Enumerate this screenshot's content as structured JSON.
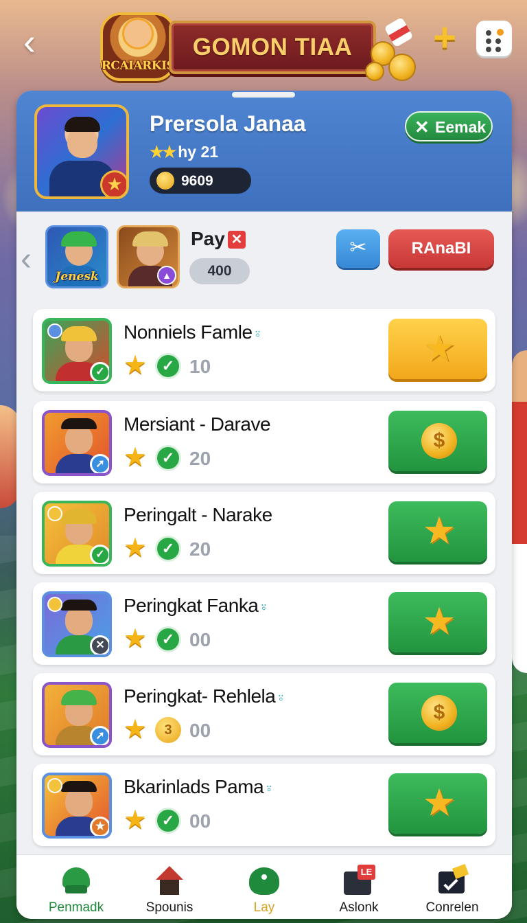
{
  "header": {
    "back_icon": "back-chevron-icon",
    "logo_text": "RCAIARKIS",
    "title": "GOMON TIAA",
    "plus_icon": "plus-icon",
    "menu_icon": "menu-dots-icon"
  },
  "profile": {
    "name": "Prersola Janaa",
    "level_stars": "★★",
    "level_text": "hy 21",
    "coins": "9609",
    "exit_label": "Eemak"
  },
  "quick_row": {
    "friend_1_label": "Jenesk",
    "pay_label": "Pay",
    "pay_value": "400",
    "rank_label": "RAnaBI"
  },
  "list": [
    {
      "name": "Nonniels Famle",
      "tag": "⍤",
      "value": "10",
      "stat_icon": "check",
      "button": "yellow",
      "button_icon": "star-icon",
      "badge": "check"
    },
    {
      "name": "Mersiant - Darave",
      "tag": "",
      "value": "20",
      "stat_icon": "check",
      "button": "green",
      "button_icon": "coin-icon",
      "badge": "arrow"
    },
    {
      "name": "Peringalt - Narake",
      "tag": "",
      "value": "20",
      "stat_icon": "check",
      "button": "green",
      "button_icon": "star-icon",
      "badge": "check"
    },
    {
      "name": "Peringkat Fanka",
      "tag": "⍤",
      "value": "00",
      "stat_icon": "check",
      "button": "green",
      "button_icon": "star-icon",
      "badge": "x"
    },
    {
      "name": "Peringkat- Rehlela",
      "tag": "⍤",
      "value": "00",
      "stat_icon": "coin",
      "stat_coin_text": "3",
      "button": "green",
      "button_icon": "coin-icon",
      "badge": "arrow"
    },
    {
      "name": "Bkarinlads Pama",
      "tag": "⍤",
      "value": "00",
      "stat_icon": "check",
      "button": "green",
      "button_icon": "star-icon",
      "badge": "star"
    }
  ],
  "nav": {
    "items": [
      {
        "label": "Penmadk",
        "icon": "team-icon"
      },
      {
        "label": "Spounis",
        "icon": "home-icon"
      },
      {
        "label": "Lay",
        "icon": "play-icon"
      },
      {
        "label": "Aslonk",
        "icon": "inbox-icon",
        "badge": "LE"
      },
      {
        "label": "Conrelen",
        "icon": "mail-icon"
      }
    ]
  },
  "colors": {
    "panel": "#eef0f3",
    "profile_bg": "#4a7fcd",
    "accent_green": "#28a745",
    "accent_red": "#d94442",
    "accent_yellow": "#f5b21a"
  }
}
